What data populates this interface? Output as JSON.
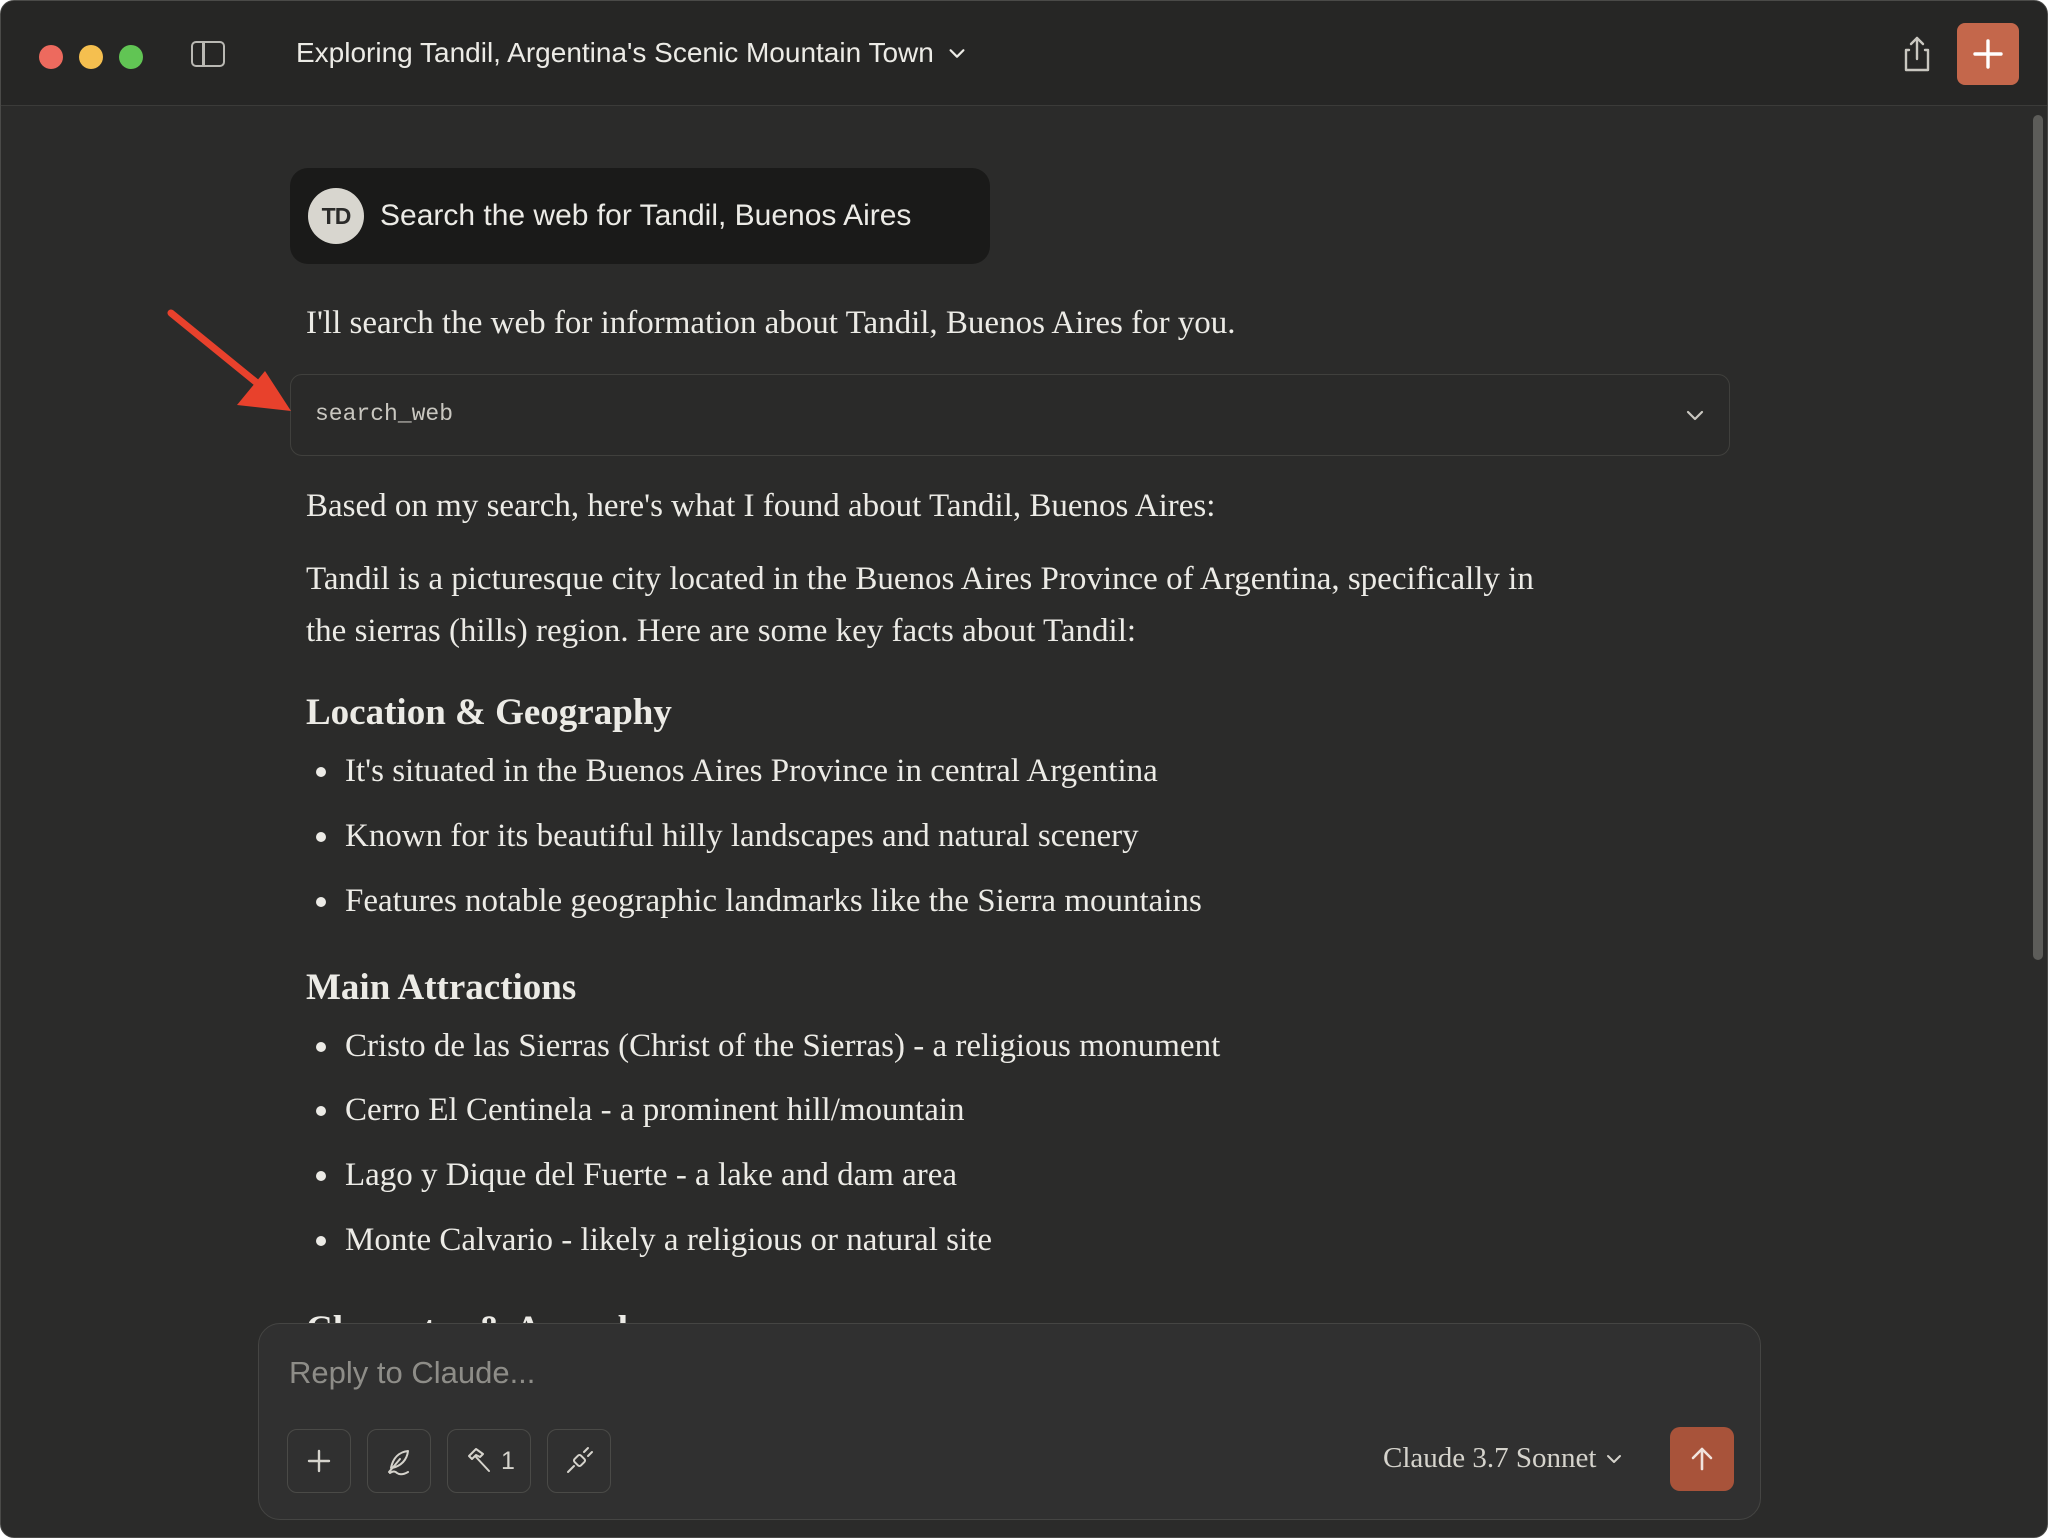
{
  "app": {
    "chat_title": "Exploring Tandil, Argentina's Scenic Mountain Town"
  },
  "user_message": {
    "avatar_initials": "TD",
    "text": "Search the web for Tandil, Buenos Aires"
  },
  "assistant": {
    "intro": "I'll search the web for information about Tandil, Buenos Aires for you.",
    "tool_call": {
      "name": "search_web"
    },
    "summary_intro": "Based on my search, here's what I found about Tandil, Buenos Aires:",
    "description_line1": "Tandil is a picturesque city located in the Buenos Aires Province of Argentina, specifically in",
    "description_line2": "the sierras (hills) region. Here are some key facts about Tandil:",
    "sections": [
      {
        "heading": "Location & Geography",
        "items": [
          "It's situated in the Buenos Aires Province in central Argentina",
          "Known for its beautiful hilly landscapes and natural scenery",
          "Features notable geographic landmarks like the Sierra mountains"
        ]
      },
      {
        "heading": "Main Attractions",
        "items": [
          "Cristo de las Sierras (Christ of the Sierras) - a religious monument",
          "Cerro El Centinela - a prominent hill/mountain",
          "Lago y Dique del Fuerte - a lake and dam area",
          "Monte Calvario - likely a religious or natural site"
        ]
      },
      {
        "heading": "Character & Appeal",
        "items": []
      }
    ]
  },
  "composer": {
    "placeholder": "Reply to Claude...",
    "tools_count": "1",
    "model_label": "Claude 3.7 Sonnet"
  },
  "colors": {
    "background": "#2b2b2a",
    "accent": "#c4674b",
    "send_button": "#a8533a",
    "annotation_arrow": "#e8412c"
  }
}
